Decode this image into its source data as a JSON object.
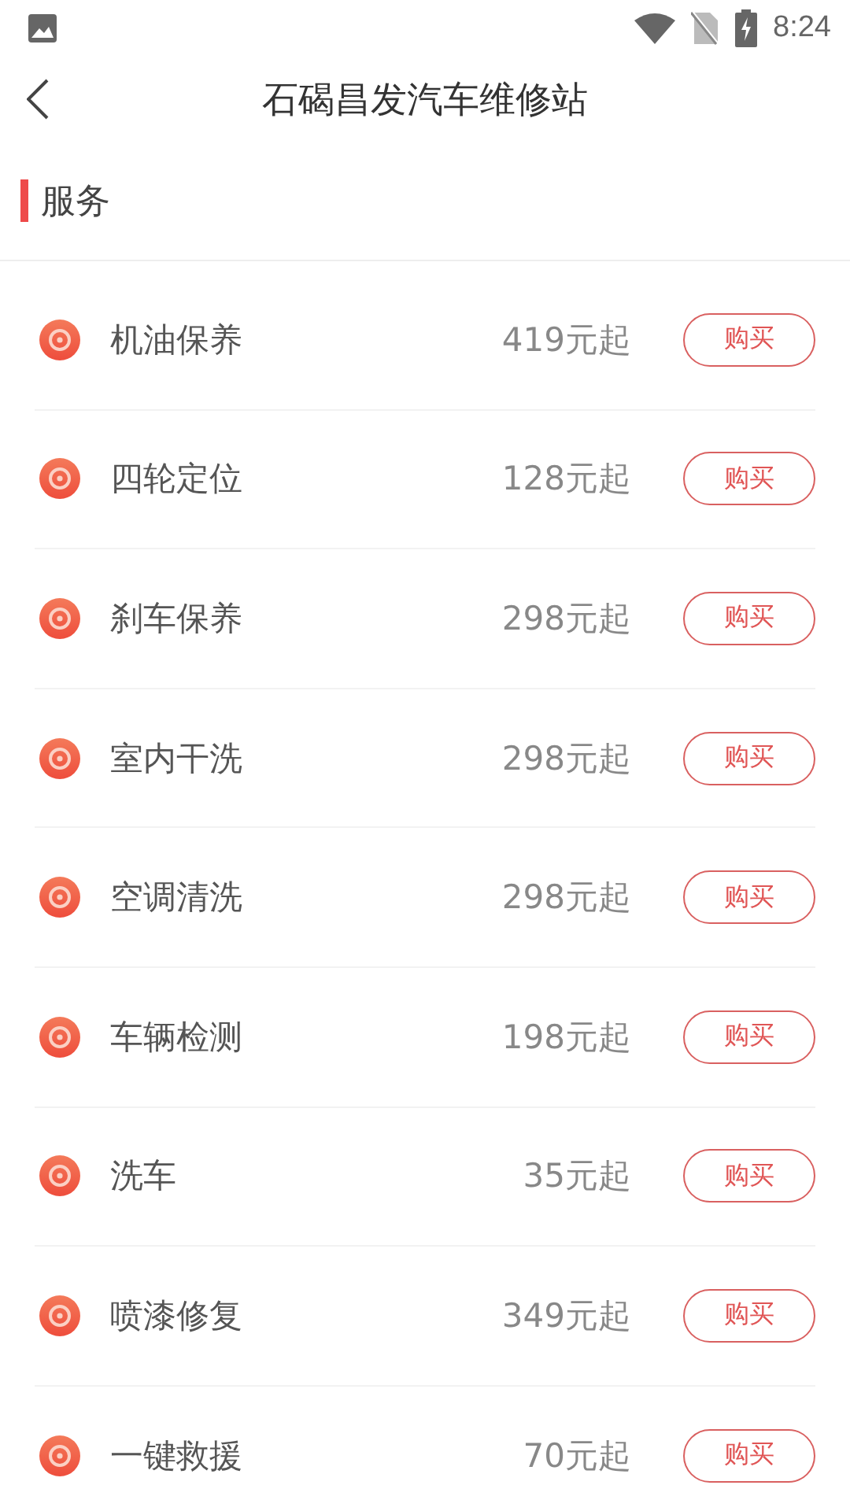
{
  "status_bar": {
    "time": "8:24"
  },
  "header": {
    "title": "石碣昌发汽车维修站"
  },
  "section": {
    "title": "服务"
  },
  "services": [
    {
      "name": "机油保养",
      "price": "419元起",
      "button": "购买"
    },
    {
      "name": "四轮定位",
      "price": "128元起",
      "button": "购买"
    },
    {
      "name": "刹车保养",
      "price": "298元起",
      "button": "购买"
    },
    {
      "name": "室内干洗",
      "price": "298元起",
      "button": "购买"
    },
    {
      "name": "空调清洗",
      "price": "298元起",
      "button": "购买"
    },
    {
      "name": "车辆检测",
      "price": "198元起",
      "button": "购买"
    },
    {
      "name": "洗车",
      "price": "35元起",
      "button": "购买"
    },
    {
      "name": "喷漆修复",
      "price": "349元起",
      "button": "购买"
    },
    {
      "name": "一键救援",
      "price": "70元起",
      "button": "购买"
    }
  ]
}
